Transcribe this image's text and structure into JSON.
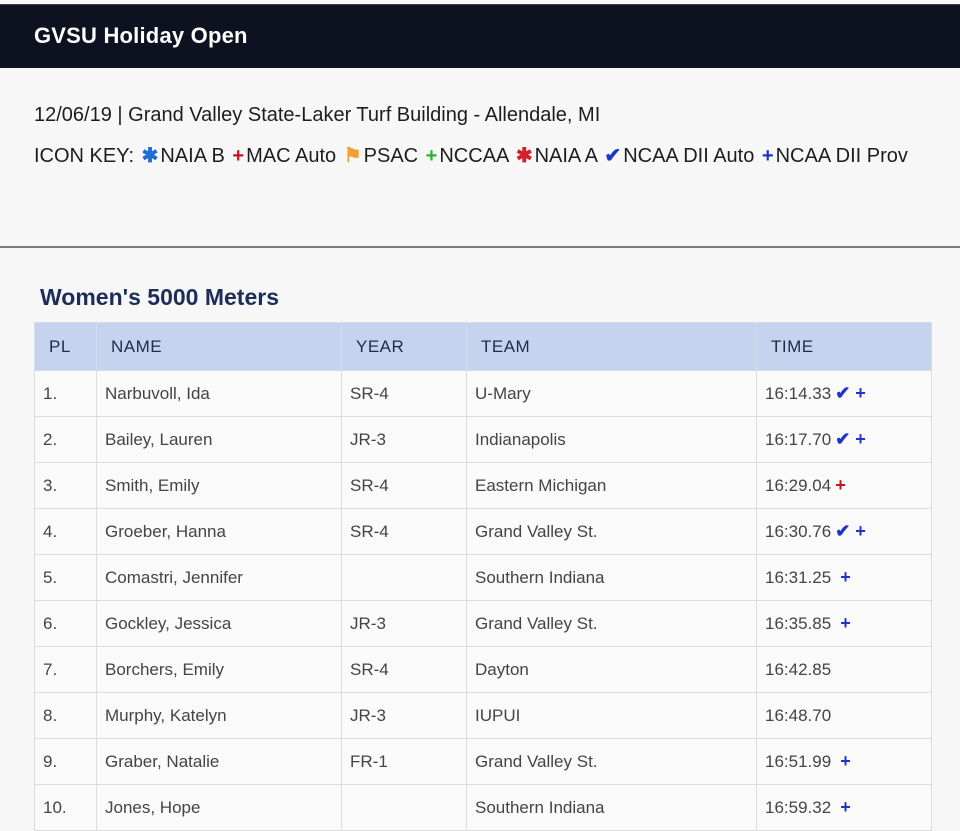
{
  "header": {
    "title": "GVSU Holiday Open"
  },
  "meet": {
    "info": "12/06/19 | Grand Valley State-Laker Turf Building - Allendale, MI",
    "icon_key_label": "ICON KEY:",
    "icon_key": [
      {
        "glyph": "✱",
        "color": "#1f6bd6",
        "label": "NAIA B"
      },
      {
        "glyph": "+",
        "color": "#c0161c",
        "label": "MAC Auto"
      },
      {
        "glyph": "⚑",
        "color": "#f0a030",
        "label": "PSAC"
      },
      {
        "glyph": "+",
        "color": "#29b529",
        "label": "NCCAA"
      },
      {
        "glyph": "✱",
        "color": "#d4202a",
        "label": "NAIA A"
      },
      {
        "glyph": "✔",
        "color": "#1f33cc",
        "label": "NCAA DII Auto"
      },
      {
        "glyph": "+",
        "color": "#1f33cc",
        "label": "NCAA DII Prov"
      }
    ]
  },
  "event": {
    "title": "Women's 5000 Meters"
  },
  "table": {
    "headers": [
      "PL",
      "NAME",
      "YEAR",
      "TEAM",
      "TIME"
    ],
    "rows": [
      {
        "pl": "1.",
        "name": "Narbuvoll, Ida",
        "year": "SR-4",
        "team": "U-Mary",
        "time": "16:14.33",
        "icons": [
          "check",
          "plus-blue"
        ]
      },
      {
        "pl": "2.",
        "name": "Bailey, Lauren",
        "year": "JR-3",
        "team": "Indianapolis",
        "time": "16:17.70",
        "icons": [
          "check",
          "plus-blue"
        ]
      },
      {
        "pl": "3.",
        "name": "Smith, Emily",
        "year": "SR-4",
        "team": "Eastern Michigan",
        "time": "16:29.04",
        "icons": [
          "plus-red"
        ]
      },
      {
        "pl": "4.",
        "name": "Groeber, Hanna",
        "year": "SR-4",
        "team": "Grand Valley St.",
        "time": "16:30.76",
        "icons": [
          "check",
          "plus-blue"
        ]
      },
      {
        "pl": "5.",
        "name": "Comastri, Jennifer",
        "year": "",
        "team": "Southern Indiana",
        "time": "16:31.25",
        "icons": [
          "plus-blue"
        ]
      },
      {
        "pl": "6.",
        "name": "Gockley, Jessica",
        "year": "JR-3",
        "team": "Grand Valley St.",
        "time": "16:35.85",
        "icons": [
          "plus-blue"
        ]
      },
      {
        "pl": "7.",
        "name": "Borchers, Emily",
        "year": "SR-4",
        "team": "Dayton",
        "time": "16:42.85",
        "icons": []
      },
      {
        "pl": "8.",
        "name": "Murphy, Katelyn",
        "year": "JR-3",
        "team": "IUPUI",
        "time": "16:48.70",
        "icons": []
      },
      {
        "pl": "9.",
        "name": "Graber, Natalie",
        "year": "FR-1",
        "team": "Grand Valley St.",
        "time": "16:51.99",
        "icons": [
          "plus-blue"
        ]
      },
      {
        "pl": "10.",
        "name": "Jones, Hope",
        "year": "",
        "team": "Southern Indiana",
        "time": "16:59.32",
        "icons": [
          "plus-blue"
        ]
      }
    ]
  }
}
